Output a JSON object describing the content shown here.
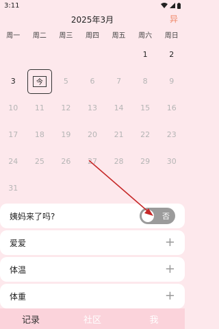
{
  "status_bar": {
    "time": "3:11"
  },
  "header": {
    "month_title": "2025年3月",
    "action_label": "异"
  },
  "weekdays": [
    "周一",
    "周二",
    "周三",
    "周四",
    "周五",
    "周六",
    "周日"
  ],
  "calendar": {
    "days": [
      {
        "label": "",
        "state": "empty"
      },
      {
        "label": "",
        "state": "empty"
      },
      {
        "label": "",
        "state": "empty"
      },
      {
        "label": "",
        "state": "empty"
      },
      {
        "label": "",
        "state": "empty"
      },
      {
        "label": "1",
        "state": "current"
      },
      {
        "label": "2",
        "state": "current"
      },
      {
        "label": "3",
        "state": "current"
      },
      {
        "label": "今",
        "state": "today"
      },
      {
        "label": "5",
        "state": "future"
      },
      {
        "label": "6",
        "state": "future"
      },
      {
        "label": "7",
        "state": "future"
      },
      {
        "label": "8",
        "state": "future"
      },
      {
        "label": "9",
        "state": "future"
      },
      {
        "label": "10",
        "state": "future"
      },
      {
        "label": "11",
        "state": "future"
      },
      {
        "label": "12",
        "state": "future"
      },
      {
        "label": "13",
        "state": "future"
      },
      {
        "label": "14",
        "state": "future"
      },
      {
        "label": "15",
        "state": "future"
      },
      {
        "label": "16",
        "state": "future"
      },
      {
        "label": "17",
        "state": "future"
      },
      {
        "label": "18",
        "state": "future"
      },
      {
        "label": "19",
        "state": "future"
      },
      {
        "label": "20",
        "state": "future"
      },
      {
        "label": "21",
        "state": "future"
      },
      {
        "label": "22",
        "state": "future"
      },
      {
        "label": "23",
        "state": "future"
      },
      {
        "label": "24",
        "state": "future"
      },
      {
        "label": "25",
        "state": "future"
      },
      {
        "label": "26",
        "state": "future"
      },
      {
        "label": "27",
        "state": "future"
      },
      {
        "label": "28",
        "state": "future"
      },
      {
        "label": "29",
        "state": "future"
      },
      {
        "label": "30",
        "state": "future"
      },
      {
        "label": "31",
        "state": "future"
      }
    ]
  },
  "period_card": {
    "label": "姨妈来了吗?",
    "toggle_label": "否"
  },
  "rows": [
    {
      "label": "爱爱",
      "action": "+"
    },
    {
      "label": "体温",
      "action": "+"
    },
    {
      "label": "体重",
      "action": "+"
    }
  ],
  "bottom_nav": {
    "items": [
      "记录",
      "社区",
      "我"
    ]
  },
  "colors": {
    "background": "#fde8ec",
    "nav": "#fbd3db",
    "accent": "#f08a6b",
    "arrow": "#c62828"
  }
}
